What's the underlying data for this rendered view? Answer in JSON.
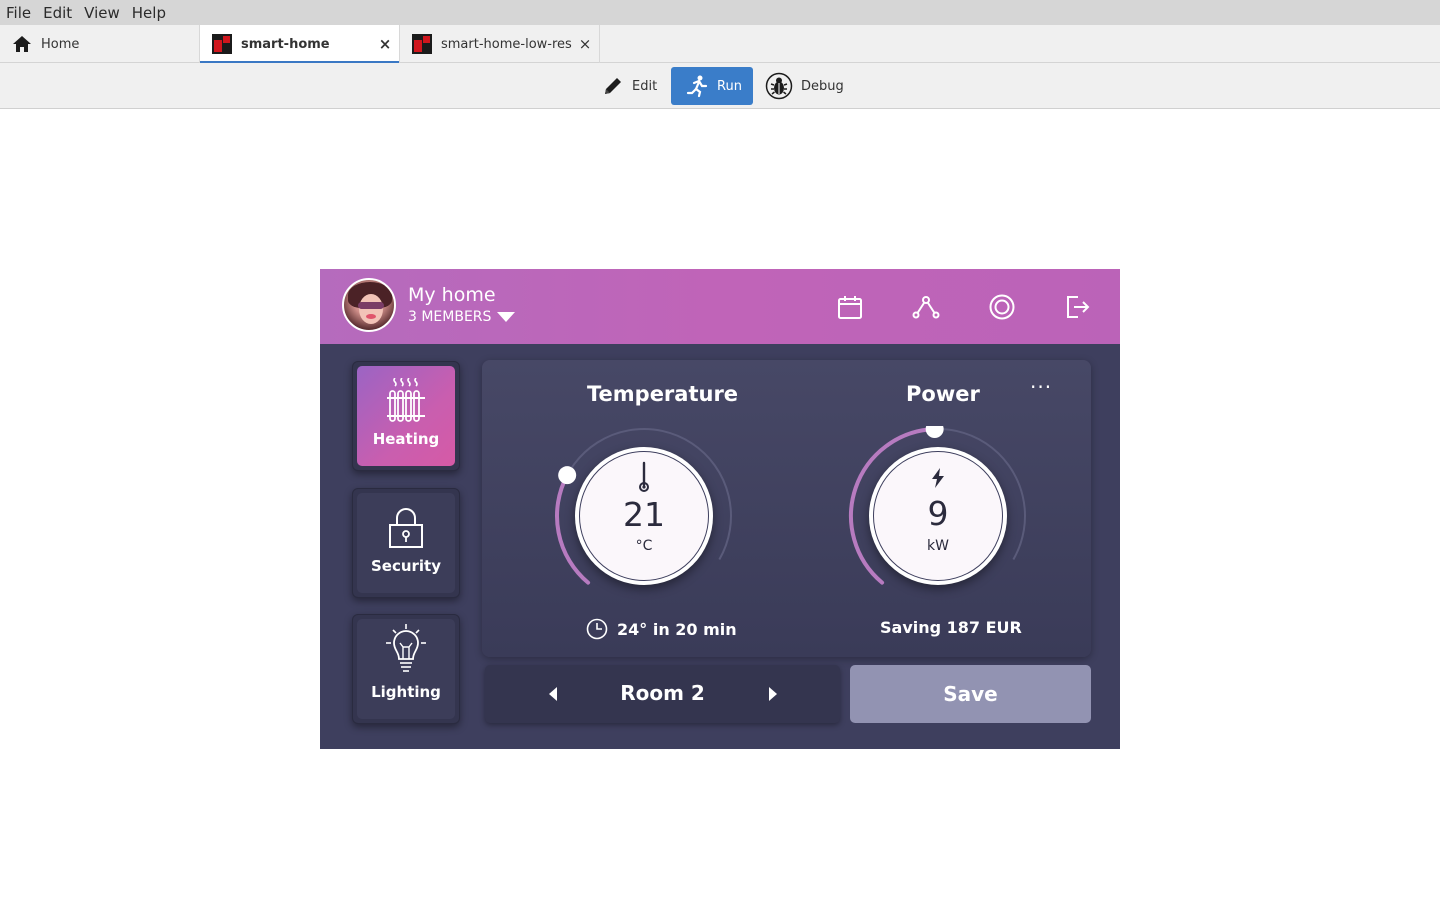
{
  "menu": [
    "File",
    "Edit",
    "View",
    "Help"
  ],
  "tabs": [
    {
      "label": "Home",
      "icon": "home-icon",
      "closable": false,
      "active": false
    },
    {
      "label": "smart-home",
      "icon": "app-logo-icon",
      "closable": true,
      "active": true
    },
    {
      "label": "smart-home-low-res",
      "icon": "app-logo-icon",
      "closable": true,
      "active": false
    }
  ],
  "tab_close_glyph": "×",
  "toolbar": {
    "edit_label": "Edit",
    "run_label": "Run",
    "debug_label": "Debug",
    "accent": "#3a7dc9"
  },
  "app": {
    "header": {
      "title": "My home",
      "members": "3 MEMBERS",
      "gradient": [
        "#b56bbd",
        "#bb63b8"
      ],
      "icons": [
        "calendar-icon",
        "graph-icon",
        "settings-icon",
        "logout-icon"
      ]
    },
    "categories": [
      {
        "label": "Heating",
        "icon": "radiator-icon",
        "active": true
      },
      {
        "label": "Security",
        "icon": "lock-icon",
        "active": false
      },
      {
        "label": "Lighting",
        "icon": "bulb-icon",
        "active": false
      }
    ],
    "temperature": {
      "title": "Temperature",
      "value": "21",
      "unit": "°C",
      "level": 0.3,
      "note": "24° in 20 min"
    },
    "power": {
      "title": "Power",
      "value": "9",
      "unit": "kW",
      "level": 0.53,
      "note": "Saving 187 EUR"
    },
    "more": "···",
    "room": {
      "label": "Room 2"
    },
    "save_label": "Save",
    "colors": {
      "panel_bg": "#3e3f5e",
      "arc_active": "#b77bc0",
      "save_bg": "#9293b2"
    }
  }
}
